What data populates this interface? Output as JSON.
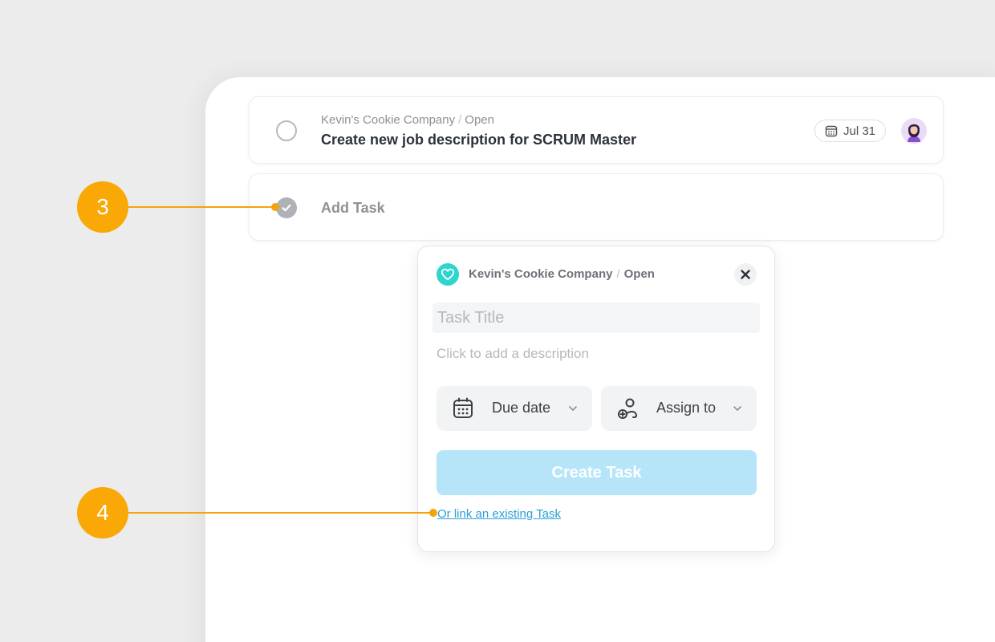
{
  "task": {
    "company": "Kevin's Cookie Company",
    "separator": "/",
    "status": "Open",
    "title": "Create new job description for SCRUM Master",
    "due": "Jul 31"
  },
  "add_task": {
    "label": "Add Task"
  },
  "popup": {
    "company": "Kevin's Cookie Company",
    "separator": "/",
    "status": "Open",
    "title_placeholder": "Task Title",
    "description_placeholder": "Click to add a description",
    "due_date_label": "Due date",
    "assign_label": "Assign to",
    "create_label": "Create Task",
    "link_existing": "Or link an existing Task"
  },
  "callouts": {
    "c3": "3",
    "c4": "4"
  },
  "colors": {
    "accent_orange": "#f9a806",
    "create_button": "#b6e5fa",
    "link_blue": "#2a9fd6",
    "company_badge": "#2ed4cf"
  },
  "icons": {
    "radio": "empty-circle-icon",
    "calendar": "calendar-icon",
    "avatar": "user-avatar",
    "check": "check-circle-icon",
    "heart": "heart-icon",
    "close": "close-icon",
    "assign": "assign-user-icon",
    "chevron": "chevron-down-icon"
  }
}
